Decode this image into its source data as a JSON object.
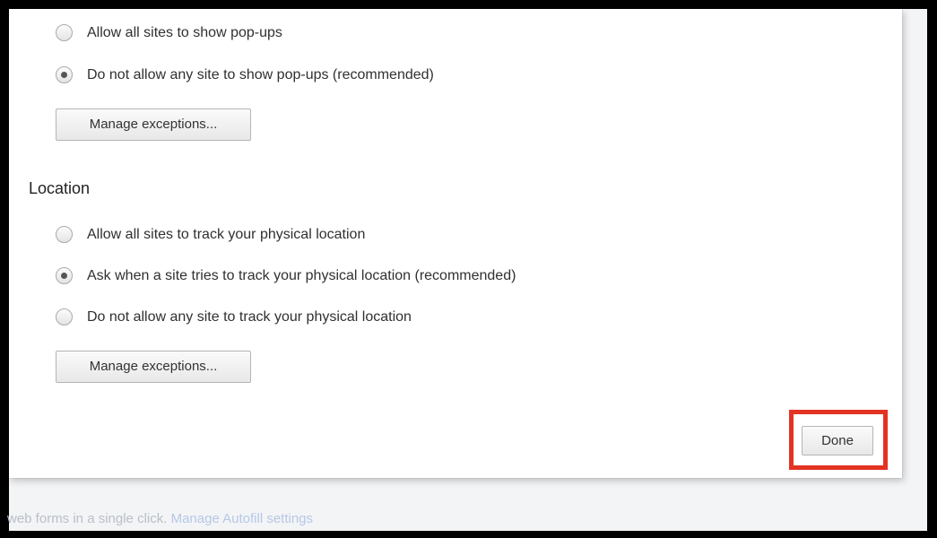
{
  "popups": {
    "options": [
      {
        "label": "Allow all sites to show pop-ups",
        "checked": false
      },
      {
        "label": "Do not allow any site to show pop-ups (recommended)",
        "checked": true
      }
    ],
    "manage_label": "Manage exceptions..."
  },
  "location": {
    "title": "Location",
    "options": [
      {
        "label": "Allow all sites to track your physical location",
        "checked": false
      },
      {
        "label": "Ask when a site tries to track your physical location (recommended)",
        "checked": true
      },
      {
        "label": "Do not allow any site to track your physical location",
        "checked": false
      }
    ],
    "manage_label": "Manage exceptions..."
  },
  "done_label": "Done",
  "background": {
    "text": "web forms in a single click.",
    "link": "Manage Autofill settings"
  },
  "colors": {
    "highlight": "#e33322",
    "link": "#b6c8e6"
  }
}
